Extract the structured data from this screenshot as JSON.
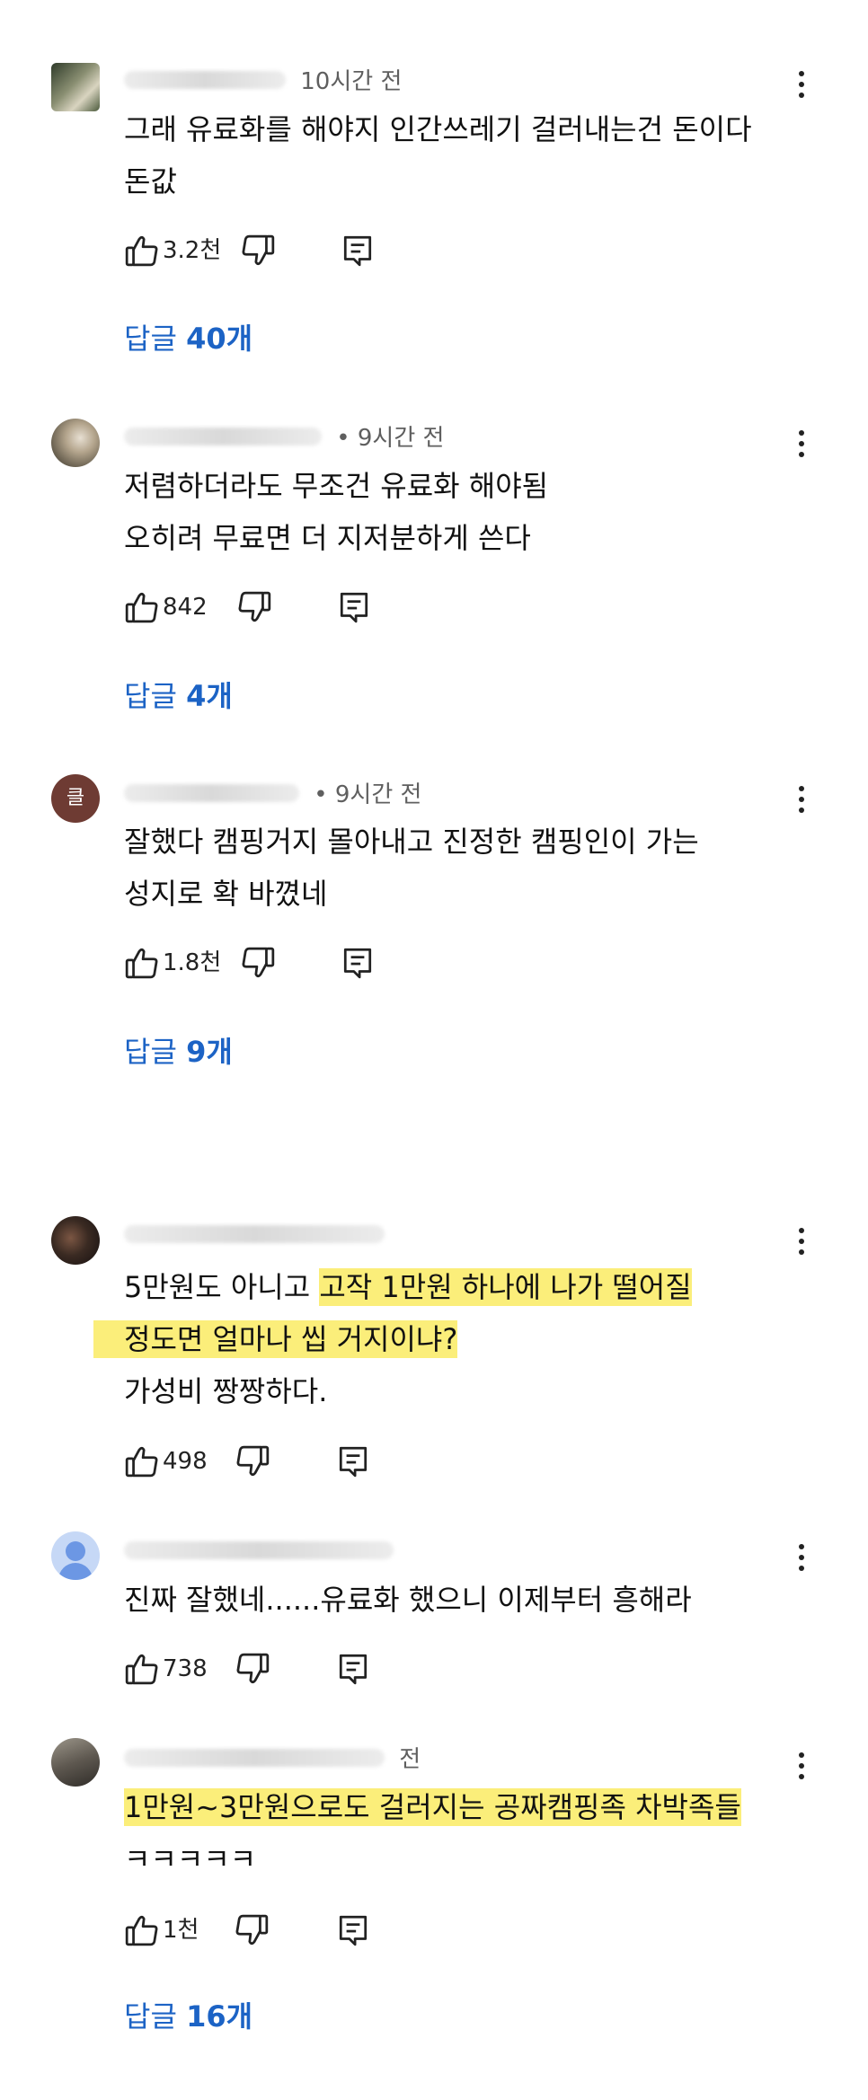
{
  "comments": [
    {
      "time": "10시간 전",
      "lines": [
        "그래 유료화를 해야지 인간쓰레기 걸러내는건 돈이다",
        "돈값"
      ],
      "likes": "3.2천",
      "reply_prefix": "답글",
      "reply_count": "40개"
    },
    {
      "time": "• 9시간 전",
      "lines": [
        "저렴하더라도 무조건 유료화 해야됨",
        "오히려 무료면 더 지저분하게 쓴다"
      ],
      "likes": "842",
      "reply_prefix": "답글",
      "reply_count": "4개"
    },
    {
      "avatar_letter": "클",
      "time": "• 9시간 전",
      "lines": [
        "잘했다 캠핑거지 몰아내고 진정한 캠핑인이 가는",
        "성지로 확 바꼈네"
      ],
      "likes": "1.8천",
      "reply_prefix": "답글",
      "reply_count": "9개"
    },
    {
      "time": "",
      "line1_plain": "5만원도 아니고 ",
      "line1_highlight": "고작 1만원 하나에 나가 떨어질",
      "line2_highlight": "정도면 얼마나 씹 거지이냐?",
      "line3": "가성비 짱짱하다.",
      "likes": "498"
    },
    {
      "time": "",
      "lines": [
        "진짜 잘했네......유료화 했으니 이제부터 흥해라"
      ],
      "likes": "738"
    },
    {
      "time": "전",
      "line1_highlight": "1만원~3만원으로도 걸러지는 공짜캠핑족 차박족들",
      "line2": "ㅋㅋㅋㅋㅋ",
      "likes": "1천",
      "reply_prefix": "답글",
      "reply_count": "16개"
    }
  ],
  "colors": {
    "highlight": "#fbee7a",
    "reply_link": "#1c63c5",
    "meta_text": "#5f5f5f"
  },
  "icons": [
    "thumbs-up-icon",
    "thumbs-down-icon",
    "reply-comment-icon",
    "more-vert-icon",
    "default-avatar-icon"
  ]
}
